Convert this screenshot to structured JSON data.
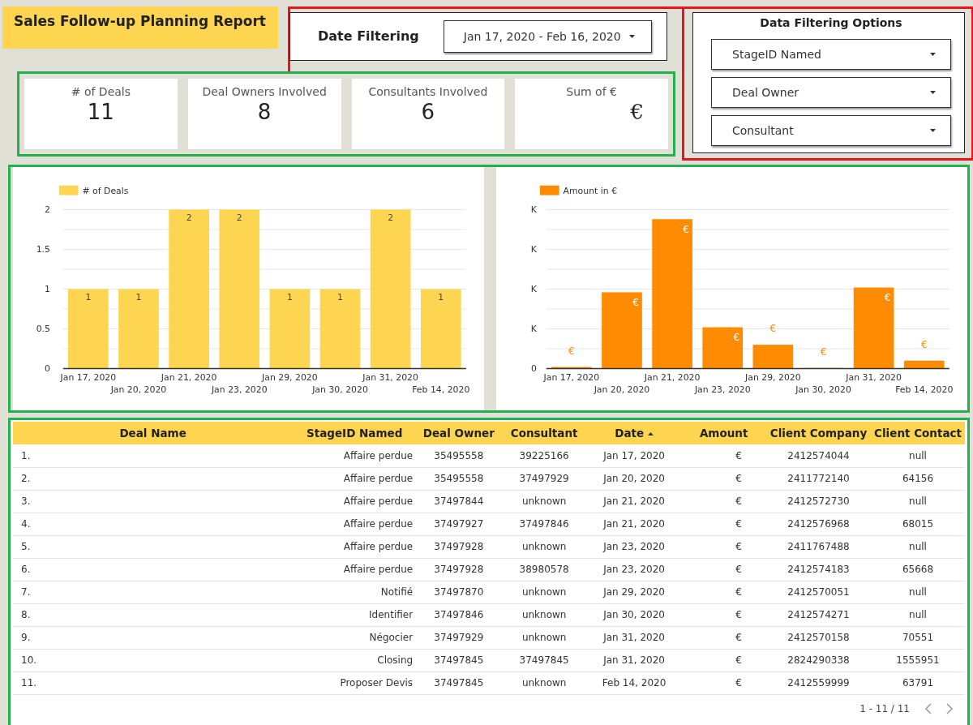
{
  "title": "Sales Follow-up Planning Report",
  "date_filter": {
    "label": "Date Filtering",
    "value": "Jan 17, 2020 - Feb 16, 2020"
  },
  "filter_options": {
    "title": "Data Filtering Options",
    "dropdowns": [
      "StageID Named",
      "Deal Owner",
      "Consultant"
    ]
  },
  "kpis": [
    {
      "label": "# of Deals",
      "value": "11"
    },
    {
      "label": "Deal Owners Involved",
      "value": "8"
    },
    {
      "label": "Consultants Involved",
      "value": "6"
    },
    {
      "label": "Sum of €",
      "value": "€"
    }
  ],
  "deals_chart": {
    "chart_data": {
      "type": "bar",
      "categories": [
        "Jan 17, 2020",
        "Jan 20, 2020",
        "Jan 21, 2020",
        "Jan 23, 2020",
        "Jan 29, 2020",
        "Jan 30, 2020",
        "Jan 31, 2020",
        "Feb 14, 2020"
      ],
      "series": [
        {
          "name": "# of Deals",
          "color": "#fed551",
          "values": [
            1,
            1,
            2,
            2,
            1,
            1,
            2,
            1
          ]
        }
      ],
      "grid": true,
      "ylim": [
        0,
        2
      ],
      "yticks": [
        0,
        0.5,
        1,
        1.5,
        2
      ],
      "data_labels": true
    }
  },
  "amount_chart": {
    "legend": "Amount in €",
    "y_labels": [
      "K",
      "K",
      "K",
      "K",
      "0"
    ],
    "x_labels": [
      "Jan 17, 2020",
      "Jan 20, 2020",
      "Jan 21, 2020",
      "Jan 23, 2020",
      "Jan 29, 2020",
      "Jan 30, 2020",
      "Jan 31, 2020",
      "Feb 14, 2020"
    ],
    "bar_labels": [
      "€",
      "€",
      "€",
      "€",
      "€",
      "€",
      "€",
      "€"
    ]
  },
  "table": {
    "columns": [
      {
        "label": "Deal Name",
        "sorted": false
      },
      {
        "label": "StageID Named",
        "sorted": false
      },
      {
        "label": "Deal Owner",
        "sorted": false
      },
      {
        "label": "Consultant",
        "sorted": false
      },
      {
        "label": "Date",
        "sorted": true
      },
      {
        "label": "Amount",
        "sorted": false
      },
      {
        "label": "Client Company",
        "sorted": false
      },
      {
        "label": "Client Contact",
        "sorted": false
      }
    ],
    "rows": [
      [
        "1.",
        "Affaire perdue",
        "35495558",
        "39225166",
        "Jan 17, 2020",
        "€",
        "2412574044",
        "null"
      ],
      [
        "2.",
        "Affaire perdue",
        "35495558",
        "37497929",
        "Jan 20, 2020",
        "€",
        "2411772140",
        "64156"
      ],
      [
        "3.",
        "Affaire perdue",
        "37497844",
        "unknown",
        "Jan 21, 2020",
        "€",
        "2412572730",
        "null"
      ],
      [
        "4.",
        "Affaire perdue",
        "37497927",
        "37497846",
        "Jan 21, 2020",
        "€",
        "2412576968",
        "68015"
      ],
      [
        "5.",
        "Affaire perdue",
        "37497928",
        "unknown",
        "Jan 23, 2020",
        "€",
        "2411767488",
        "null"
      ],
      [
        "6.",
        "Affaire perdue",
        "37497928",
        "38980578",
        "Jan 23, 2020",
        "€",
        "2412574183",
        "65668"
      ],
      [
        "7.",
        "Notifié",
        "37497870",
        "unknown",
        "Jan 29, 2020",
        "€",
        "2412570051",
        "null"
      ],
      [
        "8.",
        "Identifier",
        "37497846",
        "unknown",
        "Jan 30, 2020",
        "€",
        "2412574271",
        "null"
      ],
      [
        "9.",
        "Négocier",
        "37497929",
        "unknown",
        "Jan 31, 2020",
        "€",
        "2412570158",
        "70551"
      ],
      [
        "10.",
        "Closing",
        "37497845",
        "37497845",
        "Jan 31, 2020",
        "€",
        "2824290338",
        "1555951"
      ],
      [
        "11.",
        "Proposer Devis",
        "37497845",
        "unknown",
        "Feb 14, 2020",
        "€",
        "2412559999",
        "63791"
      ]
    ],
    "pagination": "1 - 11 / 11"
  }
}
